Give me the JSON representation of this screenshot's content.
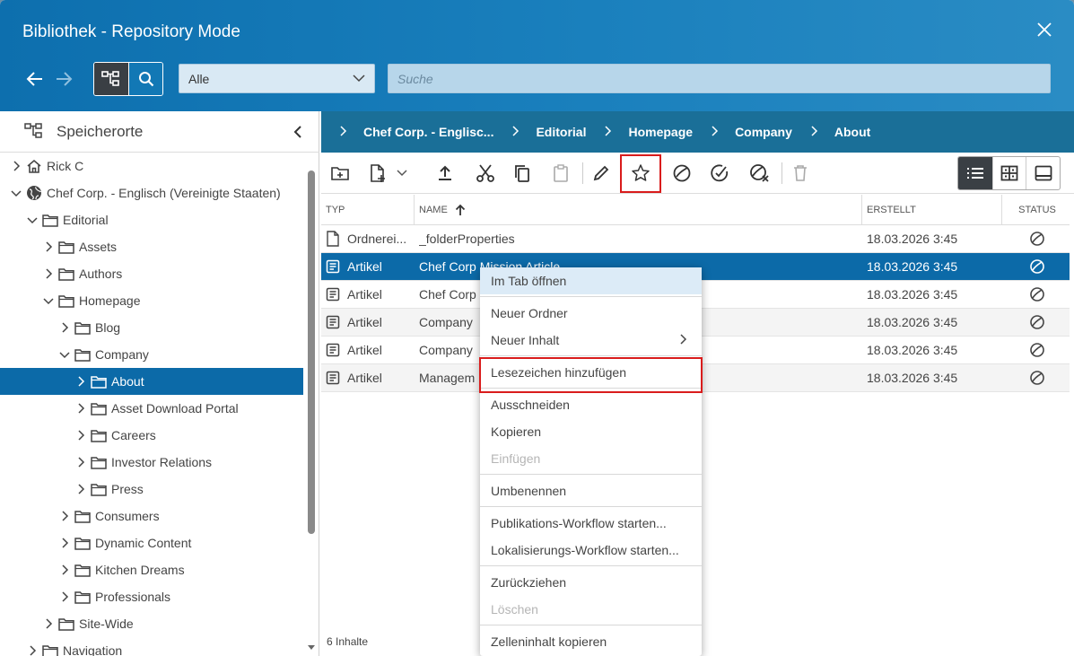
{
  "header": {
    "title": "Bibliothek - Repository Mode",
    "filter_value": "Alle",
    "search_placeholder": "Suche"
  },
  "left_panel": {
    "title": "Speicherorte",
    "tree": [
      {
        "label": "Rick C",
        "icon": "home-icon",
        "expanded": false,
        "level": 0
      },
      {
        "label": "Chef Corp. - Englisch (Vereinigte Staaten)",
        "icon": "globe-icon",
        "expanded": true,
        "level": 0
      },
      {
        "label": "Editorial",
        "icon": "folder-icon",
        "expanded": true,
        "level": 1
      },
      {
        "label": "Assets",
        "icon": "folder-icon",
        "expanded": false,
        "level": 2
      },
      {
        "label": "Authors",
        "icon": "folder-icon",
        "expanded": false,
        "level": 2
      },
      {
        "label": "Homepage",
        "icon": "folder-icon",
        "expanded": true,
        "level": 2
      },
      {
        "label": "Blog",
        "icon": "folder-icon",
        "expanded": false,
        "level": 3
      },
      {
        "label": "Company",
        "icon": "folder-icon",
        "expanded": true,
        "level": 3
      },
      {
        "label": "About",
        "icon": "folder-icon",
        "expanded": false,
        "level": 4,
        "selected": true
      },
      {
        "label": "Asset Download Portal",
        "icon": "folder-icon",
        "expanded": false,
        "level": 4
      },
      {
        "label": "Careers",
        "icon": "folder-icon",
        "expanded": false,
        "level": 4
      },
      {
        "label": "Investor Relations",
        "icon": "folder-icon",
        "expanded": false,
        "level": 4
      },
      {
        "label": "Press",
        "icon": "folder-icon",
        "expanded": false,
        "level": 4
      },
      {
        "label": "Consumers",
        "icon": "folder-icon",
        "expanded": false,
        "level": 3
      },
      {
        "label": "Dynamic Content",
        "icon": "folder-icon",
        "expanded": false,
        "level": 3
      },
      {
        "label": "Kitchen Dreams",
        "icon": "folder-icon",
        "expanded": false,
        "level": 3
      },
      {
        "label": "Professionals",
        "icon": "folder-icon",
        "expanded": false,
        "level": 3
      },
      {
        "label": "Site-Wide",
        "icon": "folder-icon",
        "expanded": false,
        "level": 2
      },
      {
        "label": "Navigation",
        "icon": "folder-icon",
        "expanded": false,
        "level": 1
      }
    ]
  },
  "breadcrumb": [
    "Chef Corp. - Englisc...",
    "Editorial",
    "Homepage",
    "Company",
    "About"
  ],
  "grid": {
    "columns": [
      "TYP",
      "NAME",
      "ERSTELLT",
      "STATUS"
    ],
    "rows": [
      {
        "type": "Ordnerei...",
        "name": "_folderProperties",
        "created": "18.03.2026 3:45",
        "type_icon": "file-icon"
      },
      {
        "type": "Artikel",
        "name": "Chef Corp Mission Article",
        "created": "18.03.2026 3:45",
        "type_icon": "article-icon",
        "selected": true
      },
      {
        "type": "Artikel",
        "name": "Chef Corp",
        "created": "18.03.2026 3:45",
        "type_icon": "article-icon"
      },
      {
        "type": "Artikel",
        "name": "Company",
        "created": "18.03.2026 3:45",
        "type_icon": "article-icon"
      },
      {
        "type": "Artikel",
        "name": "Company",
        "created": "18.03.2026 3:45",
        "type_icon": "article-icon"
      },
      {
        "type": "Artikel",
        "name": "Managem",
        "created": "18.03.2026 3:45",
        "type_icon": "article-icon"
      }
    ],
    "count": "6 Inhalte"
  },
  "context_menu": {
    "items": [
      {
        "label": "Im Tab öffnen",
        "hover": true
      },
      {
        "label": "Neuer Ordner"
      },
      {
        "label": "Neuer Inhalt",
        "submenu": true
      },
      {
        "label": "Lesezeichen hinzufügen",
        "highlighted": true
      },
      {
        "label": "Ausschneiden"
      },
      {
        "label": "Kopieren"
      },
      {
        "label": "Einfügen",
        "disabled": true
      },
      {
        "label": "Umbenennen"
      },
      {
        "label": "Publikations-Workflow starten..."
      },
      {
        "label": "Lokalisierungs-Workflow starten..."
      },
      {
        "label": "Zurückziehen"
      },
      {
        "label": "Löschen",
        "disabled": true
      },
      {
        "label": "Zelleninhalt kopieren"
      }
    ]
  },
  "colors": {
    "accent": "#0c6aa8",
    "highlight": "#d91c1c",
    "breadcrumb_bg": "#1a6f98"
  }
}
